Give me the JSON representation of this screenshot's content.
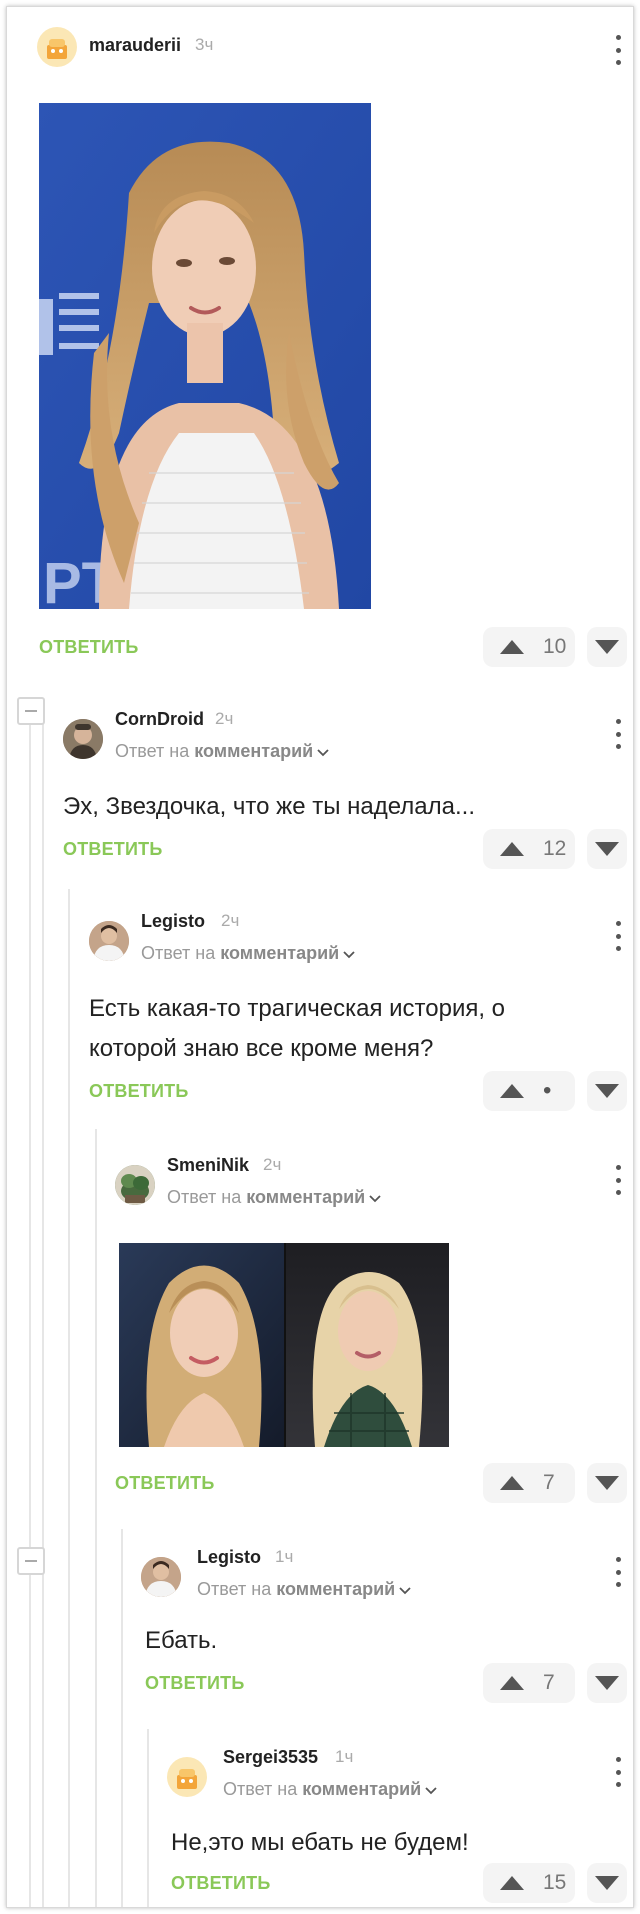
{
  "post": {
    "username": "marauderii",
    "time": "3ч",
    "reply_label": "ОТВЕТИТЬ",
    "votes": "10"
  },
  "comments": [
    {
      "username": "CornDroid",
      "time": "2ч",
      "reply_prefix": "Ответ на",
      "reply_target": "комментарий",
      "text": "Эх, Звездочка, что же ты наделала...",
      "reply_label": "ОТВЕТИТЬ",
      "votes": "12"
    },
    {
      "username": "Legisto",
      "time": "2ч",
      "reply_prefix": "Ответ на",
      "reply_target": "комментарий",
      "text": "Есть какая-то трагическая история, о которой знаю все кроме меня?",
      "reply_label": "ОТВЕТИТЬ",
      "votes": "•"
    },
    {
      "username": "SmeniNik",
      "time": "2ч",
      "reply_prefix": "Ответ на",
      "reply_target": "комментарий",
      "reply_label": "ОТВЕТИТЬ",
      "votes": "7"
    },
    {
      "username": "Legisto",
      "time": "1ч",
      "reply_prefix": "Ответ на",
      "reply_target": "комментарий",
      "text": "Ебать.",
      "reply_label": "ОТВЕТИТЬ",
      "votes": "7"
    },
    {
      "username": "Sergei3535",
      "time": "1ч",
      "reply_prefix": "Ответ на",
      "reply_target": "комментарий",
      "text": "Не,это мы ебать не будем!",
      "reply_label": "ОТВЕТИТЬ",
      "votes": "15"
    }
  ],
  "icons": {
    "upvote": "triangle-up-icon",
    "downvote": "triangle-down-icon",
    "more": "more-vertical-icon",
    "collapse": "minus-icon",
    "chevron": "chevron-down-icon"
  },
  "colors": {
    "accent": "#8ac858",
    "muted": "#999999",
    "vote_bg": "#f4f4f4"
  }
}
